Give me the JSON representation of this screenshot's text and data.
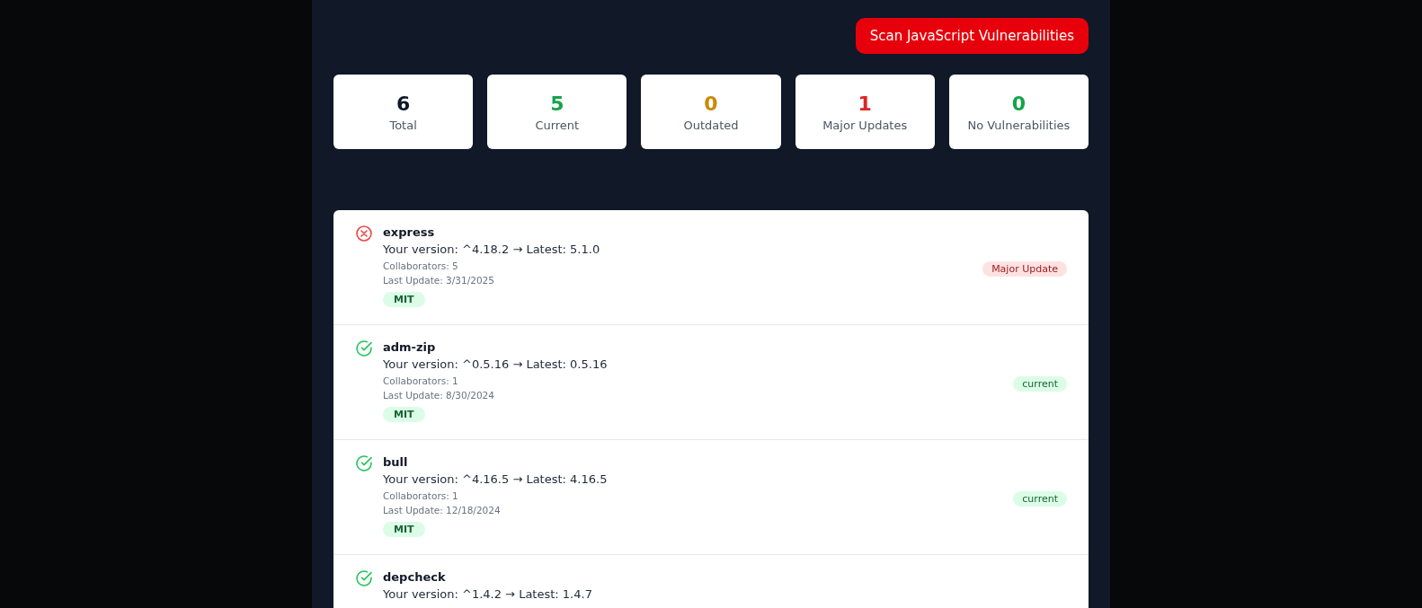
{
  "scan_button": "Scan JavaScript Vulnerabilities",
  "stats": [
    {
      "value": "6",
      "label": "Total",
      "color": "#111827"
    },
    {
      "value": "5",
      "label": "Current",
      "color": "#16a34a"
    },
    {
      "value": "0",
      "label": "Outdated",
      "color": "#ca8a04"
    },
    {
      "value": "1",
      "label": "Major Updates",
      "color": "#dc2626"
    },
    {
      "value": "0",
      "label": "No Vulnerabilities",
      "color": "#16a34a"
    }
  ],
  "packages": [
    {
      "kind": "major",
      "name": "express",
      "version": "Your version: ^4.18.2 → Latest: 5.1.0",
      "collaborators": "Collaborators: 5",
      "last_update": "Last Update: 3/31/2025",
      "license": "MIT",
      "status": "Major Update"
    },
    {
      "kind": "current",
      "name": "adm-zip",
      "version": "Your version: ^0.5.16 → Latest: 0.5.16",
      "collaborators": "Collaborators: 1",
      "last_update": "Last Update: 8/30/2024",
      "license": "MIT",
      "status": "current"
    },
    {
      "kind": "current",
      "name": "bull",
      "version": "Your version: ^4.16.5 → Latest: 4.16.5",
      "collaborators": "Collaborators: 1",
      "last_update": "Last Update: 12/18/2024",
      "license": "MIT",
      "status": "current"
    },
    {
      "kind": "current",
      "name": "depcheck",
      "version": "Your version: ^1.4.2 → Latest: 1.4.7"
    }
  ]
}
